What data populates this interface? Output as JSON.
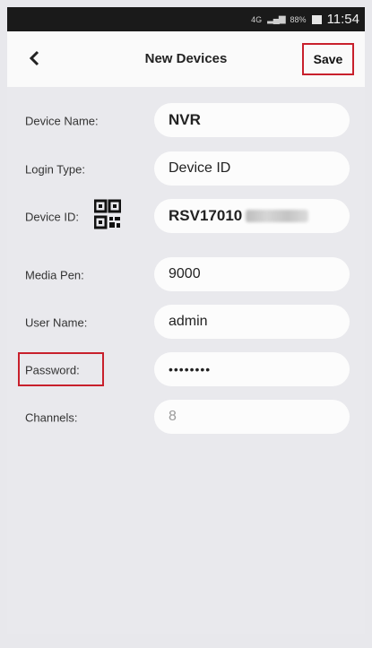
{
  "status_bar": {
    "network": "4G",
    "battery_pct": "88%",
    "time": "11:54"
  },
  "header": {
    "title": "New Devices",
    "save_label": "Save",
    "back_icon": "chevron-left-icon"
  },
  "form": {
    "device_name": {
      "label": "Device Name:",
      "value": "NVR"
    },
    "login_type": {
      "label": "Login Type:",
      "value": "Device ID"
    },
    "device_id": {
      "label": "Device ID:",
      "value": "RSV17010",
      "icon": "qr-code-icon"
    },
    "media_port": {
      "label": "Media Pen:",
      "value": "9000"
    },
    "user_name": {
      "label": "User Name:",
      "value": "admin"
    },
    "password": {
      "label": "Password:",
      "value": "••••••••"
    },
    "channels": {
      "label": "Channels:",
      "value": "8"
    }
  },
  "colors": {
    "highlight": "#c8202c",
    "background": "#e9e9ed",
    "field": "#fcfcfc"
  }
}
